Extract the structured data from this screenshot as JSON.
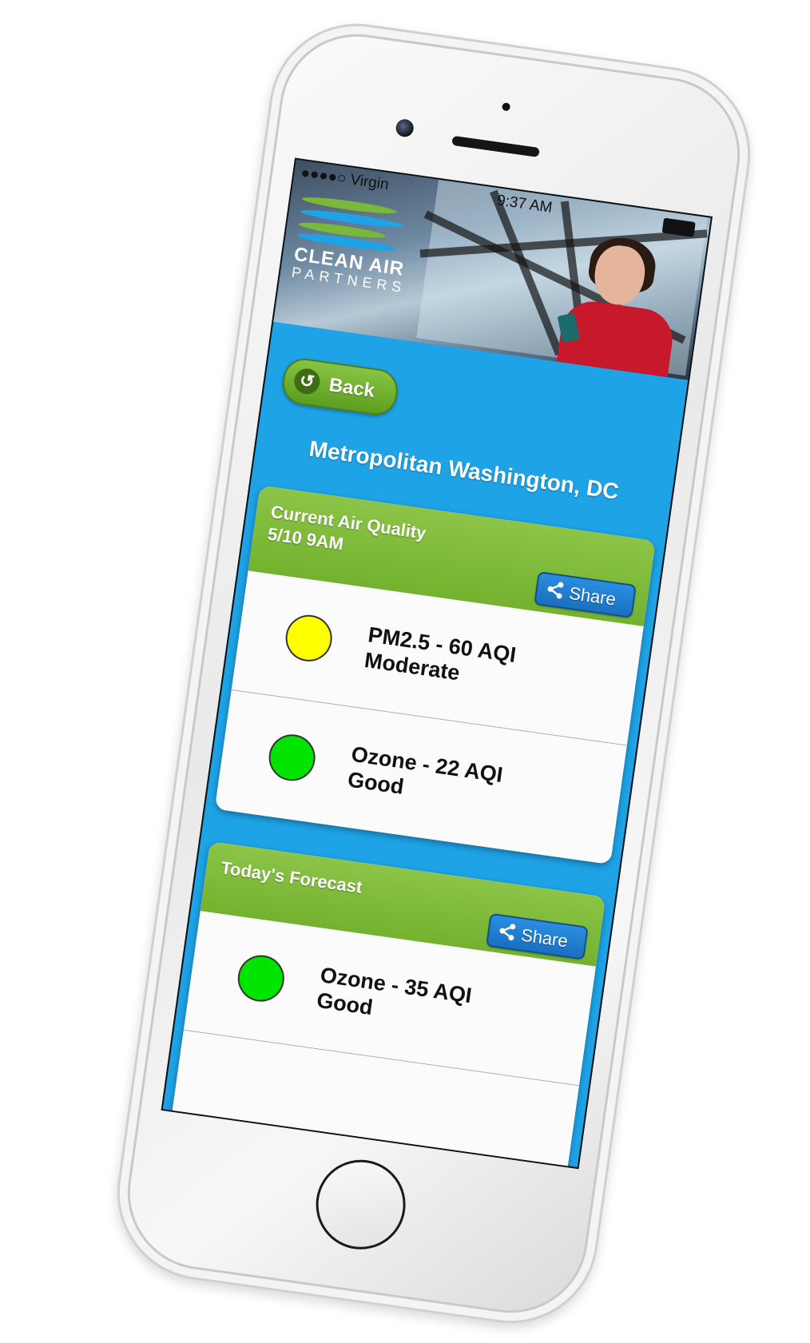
{
  "status_bar": {
    "carrier": "●●●●○ Virgin",
    "time": "9:37 AM"
  },
  "logo": {
    "line1": "CLEAN AIR",
    "line2": "PARTNERS"
  },
  "nav": {
    "back_label": "Back"
  },
  "location": "Metropolitan Washington, DC",
  "current": {
    "title": "Current Air Quality",
    "timestamp": "5/10 9AM",
    "share_label": "Share",
    "readings": [
      {
        "line1": "PM2.5 - 60 AQI",
        "line2": "Moderate",
        "color": "#ffff00"
      },
      {
        "line1": "Ozone - 22 AQI",
        "line2": "Good",
        "color": "#00e400"
      }
    ]
  },
  "forecast": {
    "title": "Today's Forecast",
    "share_label": "Share",
    "readings": [
      {
        "line1": "Ozone - 35 AQI",
        "line2": "Good",
        "color": "#00e400"
      }
    ]
  },
  "colors": {
    "screen_bg": "#1ea3e6",
    "header_green": "#7ab83a",
    "share_blue": "#1f7fd0"
  }
}
